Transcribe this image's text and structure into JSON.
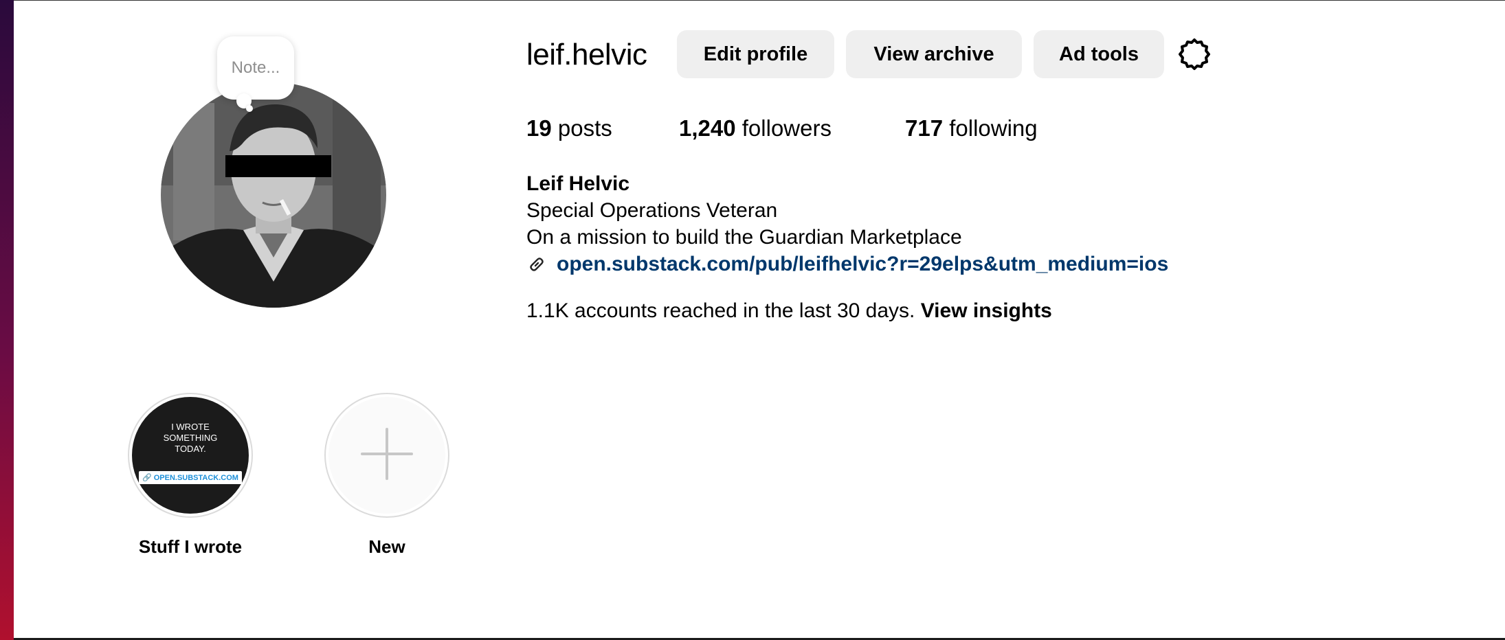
{
  "profile": {
    "username": "leif.helvic",
    "note_placeholder": "Note...",
    "buttons": {
      "edit_profile": "Edit profile",
      "view_archive": "View archive",
      "ad_tools": "Ad tools"
    },
    "stats": {
      "posts_count": "19",
      "posts_label": "posts",
      "followers_count": "1,240",
      "followers_label": "followers",
      "following_count": "717",
      "following_label": "following"
    },
    "bio": {
      "name": "Leif Helvic",
      "line1": "Special Operations Veteran",
      "line2": "On a mission to build the Guardian Marketplace",
      "link": "open.substack.com/pub/leifhelvic?r=29elps&utm_medium=ios"
    },
    "insights": {
      "text": "1.1K accounts reached in the last 30 days.",
      "link": "View insights"
    }
  },
  "highlights": [
    {
      "label": "Stuff I wrote",
      "cover_text": "I WROTE SOMETHING TODAY.",
      "cover_chip": "OPEN.SUBSTACK.COM"
    },
    {
      "label": "New"
    }
  ],
  "colors": {
    "link": "#00376b",
    "button_bg": "#efefef",
    "muted": "#8e8e8e"
  }
}
